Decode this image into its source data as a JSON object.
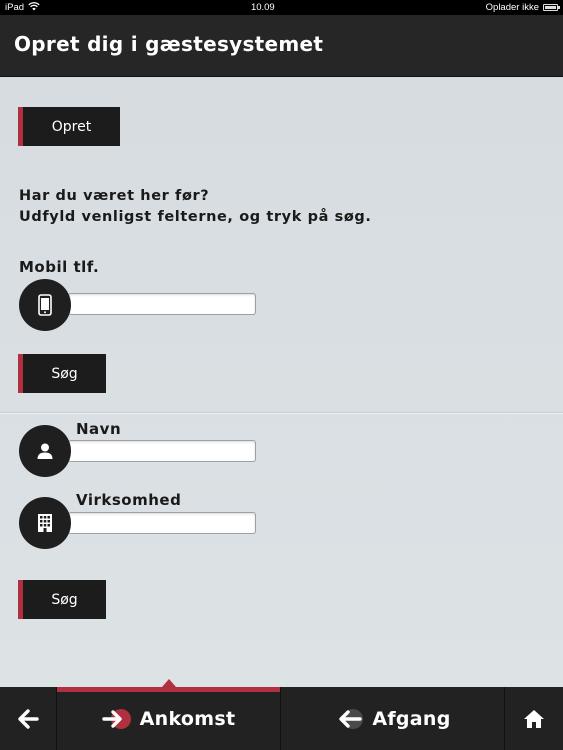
{
  "status_bar": {
    "device": "iPad",
    "time": "10.09",
    "charging": "Oplader ikke"
  },
  "header": {
    "title": "Opret dig i gæstesystemet"
  },
  "main": {
    "create_button": "Opret",
    "intro_line1": "Har du været her før?",
    "intro_line2": "Udfyld venligst felterne, og tryk på søg.",
    "phone_label": "Mobil tlf.",
    "phone_value": "",
    "search_button_1": "Søg",
    "name_label": "Navn",
    "name_value": "",
    "company_label": "Virksomhed",
    "company_value": "",
    "search_button_2": "Søg"
  },
  "bottom_nav": {
    "arrival": "Ankomst",
    "departure": "Afgang",
    "active_tab": "arrival"
  },
  "colors": {
    "accent": "#b0303f",
    "dark": "#1c1c1c",
    "background": "#d9dfe3"
  },
  "icons": [
    "wifi-icon",
    "battery-icon",
    "phone-icon",
    "user-icon",
    "building-icon",
    "back-arrow-icon",
    "arrival-arrow-icon",
    "departure-arrow-icon",
    "home-icon"
  ]
}
